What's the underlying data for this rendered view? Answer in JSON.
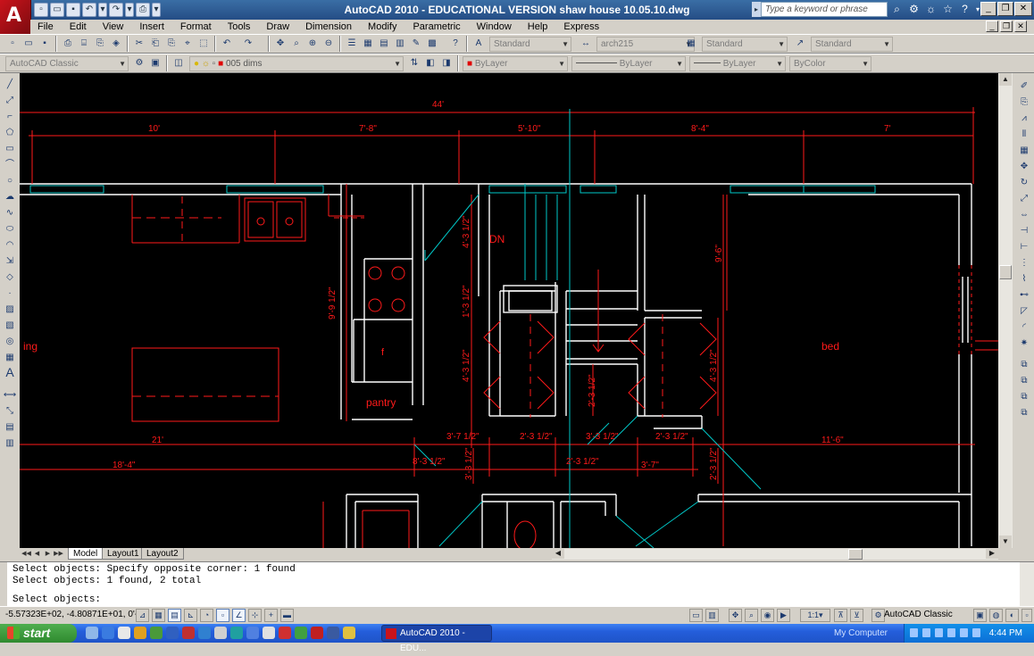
{
  "window": {
    "title": "AutoCAD 2010 - EDUCATIONAL VERSION    shaw house 10.05.10.dwg",
    "search_placeholder": "Type a keyword or phrase",
    "logo_letter": "A"
  },
  "menu": {
    "items": [
      "File",
      "Edit",
      "View",
      "Insert",
      "Format",
      "Tools",
      "Draw",
      "Dimension",
      "Modify",
      "Parametric",
      "Window",
      "Help",
      "Express"
    ]
  },
  "toolbar1": {
    "text_style": "Standard",
    "dim_style": "arch215",
    "table_style": "Standard",
    "multileader_style": "Standard"
  },
  "toolbar2": {
    "workspace": "AutoCAD Classic",
    "layer": "005 dims",
    "color": "ByLayer",
    "linetype": "ByLayer",
    "lineweight": "ByLayer",
    "plotstyle": "ByColor"
  },
  "drawing": {
    "dimensions_top": {
      "overall": "44'",
      "d1": "10'",
      "d2": "7'-8\"",
      "d3": "5'-10\"",
      "d4": "8'-4\"",
      "d5": "7'"
    },
    "rooms": {
      "living": "ing",
      "pantry": "pantry",
      "bed": "bed",
      "dn": "DN",
      "fridge": "f"
    },
    "dims_vertical": [
      "4'-3 1/2\"",
      "9'-9 1/2\"",
      "1'-3 1/2\"",
      "4'-3 1/2\"",
      "9'-6\"",
      "4'-3 1/2\"",
      "2'-3 1/2\"",
      "3'-3 1/2\"",
      "2'-3 1/2\""
    ],
    "dims_row1": [
      "21'",
      "3'-7 1/2\"",
      "2'-3 1/2\"",
      "3'-3 1/2\"",
      "2'-3 1/2\"",
      "11'-6\""
    ],
    "dims_row2": [
      "18'-4\"",
      "8'-3 1/2\"",
      "2'-3 1/2\"",
      "3'-7\""
    ]
  },
  "tabs": [
    "Model",
    "Layout1",
    "Layout2"
  ],
  "active_tab": "Model",
  "command": {
    "lines": [
      "Select objects: Specify opposite corner: 1 found",
      "Select objects: 1 found, 2 total",
      "",
      "Select objects:"
    ]
  },
  "status": {
    "coords": "-5.57323E+02, -4.80871E+01, 0'-0\"",
    "annotation_scale": "1:1",
    "workspace": "AutoCAD Classic"
  },
  "taskbar": {
    "start_label": "start",
    "app_label": "AutoCAD 2010 - EDU...",
    "my_computer": "My Computer",
    "clock": "4:44 PM"
  },
  "colors": {
    "titlebar": "#254d85",
    "drawing_bg": "#000000",
    "dim_red": "#ff1a1a",
    "wall_white": "#ffffff",
    "cyan": "#00c8c8",
    "taskbar": "#245edb"
  }
}
